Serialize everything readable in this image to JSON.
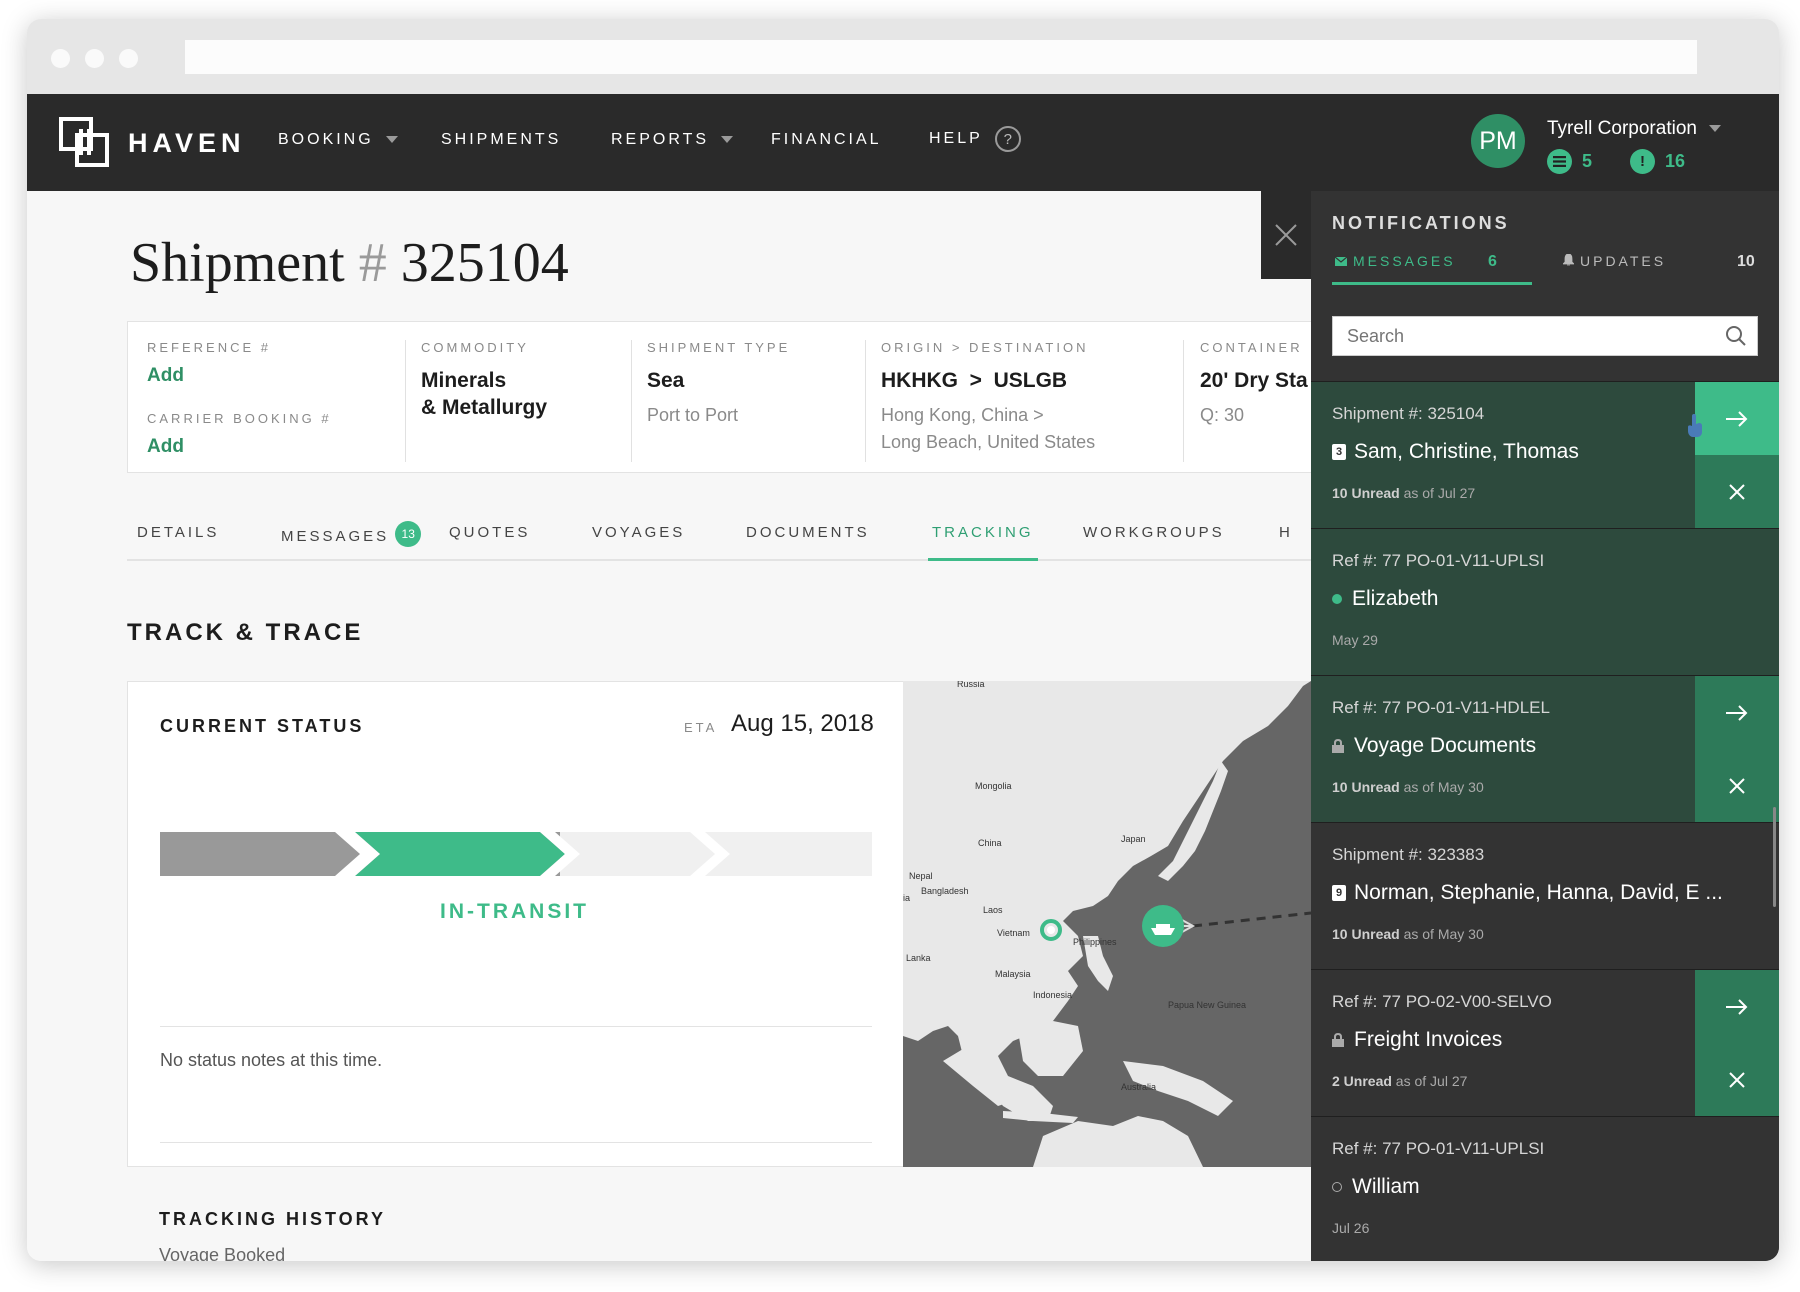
{
  "nav": {
    "brand": "HAVEN",
    "items": [
      {
        "label": "BOOKING",
        "dropdown": true
      },
      {
        "label": "SHIPMENTS",
        "dropdown": false
      },
      {
        "label": "REPORTS",
        "dropdown": true
      },
      {
        "label": "FINANCIAL",
        "dropdown": false
      },
      {
        "label": "HELP",
        "dropdown": false
      }
    ],
    "help_glyph": "?",
    "user_initials": "PM",
    "org_name": "Tyrell Corporation",
    "messages_count": "5",
    "alerts_count": "16",
    "alert_glyph": "!"
  },
  "page": {
    "title_prefix": "Shipment",
    "title_hash": "#",
    "title_number": "325104"
  },
  "summary": {
    "reference_label": "REFERENCE #",
    "reference_value": "Add",
    "carrier_booking_label": "CARRIER BOOKING #",
    "carrier_booking_value": "Add",
    "commodity_label": "COMMODITY",
    "commodity_line1": "Minerals",
    "commodity_line2": "& Metallurgy",
    "shipment_type_label": "SHIPMENT TYPE",
    "shipment_type_value": "Sea",
    "shipment_type_sub": "Port to Port",
    "route_label": "ORIGIN > DESTINATION",
    "route_value": "HKHKG  >  USLGB",
    "route_sub1": "Hong Kong, China  >",
    "route_sub2": "Long Beach, United States",
    "container_label": "CONTAINER",
    "container_value": "20' Dry Sta",
    "container_sub": "Q: 30"
  },
  "tabs": [
    {
      "label": "DETAILS"
    },
    {
      "label": "MESSAGES",
      "count": "13"
    },
    {
      "label": "QUOTES"
    },
    {
      "label": "VOYAGES"
    },
    {
      "label": "DOCUMENTS"
    },
    {
      "label": "TRACKING",
      "active": true
    },
    {
      "label": "WORKGROUPS"
    },
    {
      "label": "H"
    }
  ],
  "tracking": {
    "section_title": "TRACK & TRACE",
    "card_title": "CURRENT STATUS",
    "eta_label": "ETA",
    "eta_value": "Aug 15, 2018",
    "status": "IN-TRANSIT",
    "progress_stage": 2,
    "progress_total": 4,
    "notes": "No status notes at this time.",
    "history_title": "TRACKING HISTORY",
    "history_first": "Voyage Booked"
  },
  "map": {
    "labels": [
      "Russia",
      "Mongolia",
      "China",
      "Japan",
      "Nepal",
      "Bangladesh",
      "Laos",
      "Vietnam",
      "Philippines",
      "Lanka",
      "Malaysia",
      "Indonesia",
      "Papua New Guinea",
      "Australia",
      "ia"
    ]
  },
  "notifications": {
    "title": "NOTIFICATIONS",
    "messages_tab": "MESSAGES",
    "messages_count": "6",
    "updates_tab": "UPDATES",
    "updates_count": "10",
    "search_placeholder": "Search",
    "items": [
      {
        "ref": "Shipment #: 325104",
        "name": "Sam, Christine, Thomas",
        "marker": "3",
        "unread": "10 Unread",
        "asof": " as of Jul 27"
      },
      {
        "ref": "Ref #: 77 PO-01-V11-UPLSI",
        "name": "Elizabeth",
        "date": "May 29"
      },
      {
        "ref": "Ref #: 77 PO-01-V11-HDLEL",
        "name": "Voyage Documents",
        "unread": "10 Unread",
        "asof": " as of May 30"
      },
      {
        "ref": "Shipment #: 323383",
        "name": "Norman, Stephanie, Hanna, David, E ...",
        "marker": "9",
        "unread": "10 Unread",
        "asof": " as of May 30"
      },
      {
        "ref": "Ref #: 77 PO-02-V00-SELVO",
        "name": "Freight Invoices",
        "unread": "2 Unread",
        "asof": " as of Jul 27"
      },
      {
        "ref": "Ref #: 77 PO-01-V11-UPLSI",
        "name": "William",
        "date": "Jul 26"
      }
    ]
  },
  "colors": {
    "accent": "#3ebb89",
    "accent_dark": "#2f8f65",
    "nav_bg": "#2a2a2a",
    "panel_bg": "#333333",
    "panel_highlight": "#2d4a3d"
  },
  "icons": [
    "logo-mark-icon",
    "caret-down-icon",
    "help-icon",
    "list-icon",
    "alert-icon",
    "close-icon",
    "mail-icon",
    "bell-icon",
    "search-icon",
    "arrow-right-icon",
    "lock-icon",
    "ship-icon",
    "location-pin-icon",
    "cursor-hand-icon"
  ]
}
